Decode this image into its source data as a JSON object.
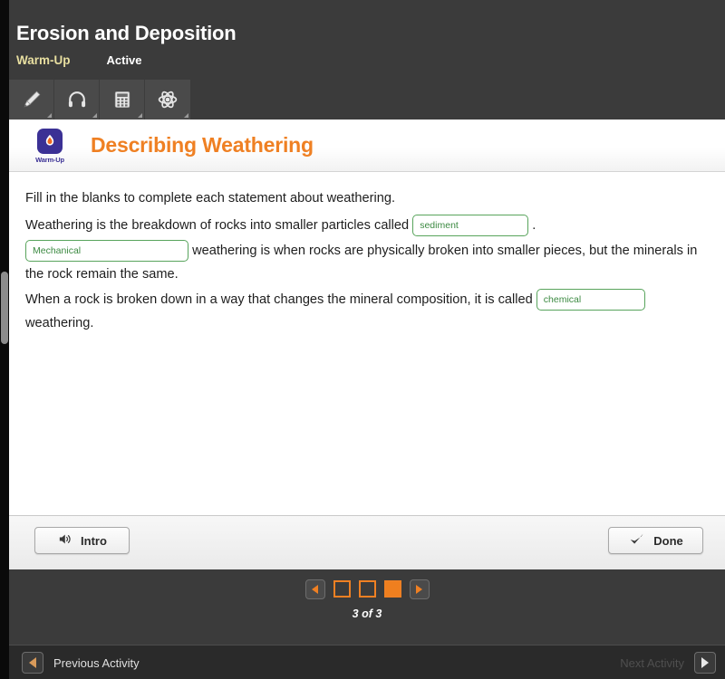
{
  "header": {
    "title": "Erosion and Deposition",
    "tabs": [
      {
        "label": "Warm-Up",
        "state": "selected",
        "color": "#e8dfa0"
      },
      {
        "label": "Active",
        "state": "normal",
        "color": "#ffffff"
      }
    ]
  },
  "toolbar": {
    "items": [
      {
        "icon": "highlighter-icon",
        "label": "Highlighter"
      },
      {
        "icon": "headphones-icon",
        "label": "Audio"
      },
      {
        "icon": "calculator-icon",
        "label": "Calculator"
      },
      {
        "icon": "atom-icon",
        "label": "Science Tools"
      }
    ]
  },
  "card": {
    "badge_label": "Warm-Up",
    "badge_icon": "flame-icon",
    "title": "Describing Weathering",
    "title_color": "#ef8023",
    "instruction": "Fill in the blanks to complete each statement about weathering.",
    "statements": [
      {
        "before": "Weathering is the breakdown of rocks into smaller particles called",
        "input": {
          "name": "blank-sediment",
          "value": "sediment",
          "placeholder": ""
        },
        "after": "."
      },
      {
        "before": "",
        "input": {
          "name": "blank-mechanical",
          "value": "Mechanical",
          "placeholder": ""
        },
        "after": "weathering is when rocks are physically broken into smaller pieces, but the minerals in the rock remain the same."
      },
      {
        "before": "When a rock is broken down in a way that changes the mineral composition, it is called",
        "input": {
          "name": "blank-chemical",
          "value": "chemical",
          "placeholder": ""
        },
        "after": "weathering."
      }
    ],
    "input_border_color": "#58a45c",
    "input_text_color": "#3c8a42"
  },
  "card_footer": {
    "intro_button": {
      "label": "Intro",
      "icon": "speaker-icon"
    },
    "done_button": {
      "label": "Done",
      "icon": "check-icon"
    }
  },
  "pager": {
    "prev_icon": "triangle-left-icon",
    "next_icon": "triangle-right-icon",
    "pages": [
      {
        "number": 1,
        "current": false
      },
      {
        "number": 2,
        "current": false
      },
      {
        "number": 3,
        "current": true
      }
    ],
    "count_text": "3 of 3",
    "accent_color": "#ef8023"
  },
  "bottom_nav": {
    "previous": {
      "label": "Previous Activity",
      "icon": "triangle-left-icon",
      "enabled": true
    },
    "next": {
      "label": "Next Activity",
      "icon": "triangle-right-icon",
      "enabled": false
    }
  }
}
